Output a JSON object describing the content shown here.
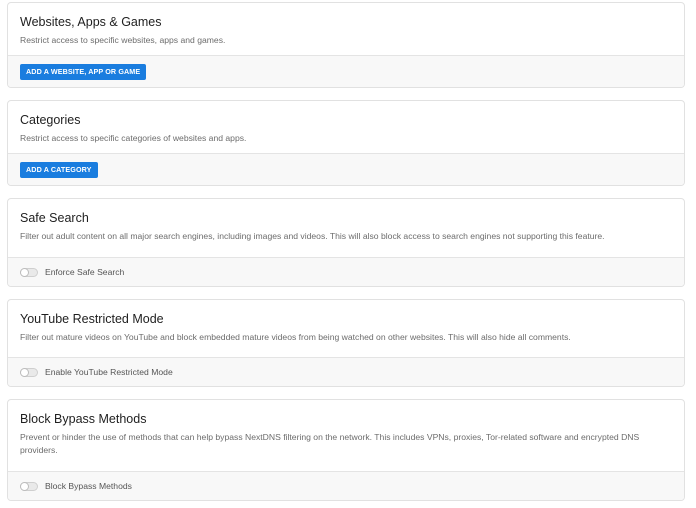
{
  "cards": [
    {
      "title": "Websites, Apps & Games",
      "description": "Restrict access to specific websites, apps and games.",
      "button_label": "ADD A WEBSITE, APP OR GAME"
    },
    {
      "title": "Categories",
      "description": "Restrict access to specific categories of websites and apps.",
      "button_label": "ADD A CATEGORY"
    },
    {
      "title": "Safe Search",
      "description": "Filter out adult content on all major search engines, including images and videos. This will also block access to search engines not supporting this feature.",
      "toggle_label": "Enforce Safe Search",
      "toggle_on": false
    },
    {
      "title": "YouTube Restricted Mode",
      "description": "Filter out mature videos on YouTube and block embedded mature videos from being watched on other websites. This will also hide all comments.",
      "toggle_label": "Enable YouTube Restricted Mode",
      "toggle_on": false
    },
    {
      "title": "Block Bypass Methods",
      "description": "Prevent or hinder the use of methods that can help bypass NextDNS filtering on the network. This includes VPNs, proxies, Tor-related software and encrypted DNS providers.",
      "toggle_label": "Block Bypass Methods",
      "toggle_on": false
    }
  ],
  "colors": {
    "accent": "#1a7ddf",
    "footer_bg": "#f8f8f8",
    "border": "#e1e1e1"
  }
}
